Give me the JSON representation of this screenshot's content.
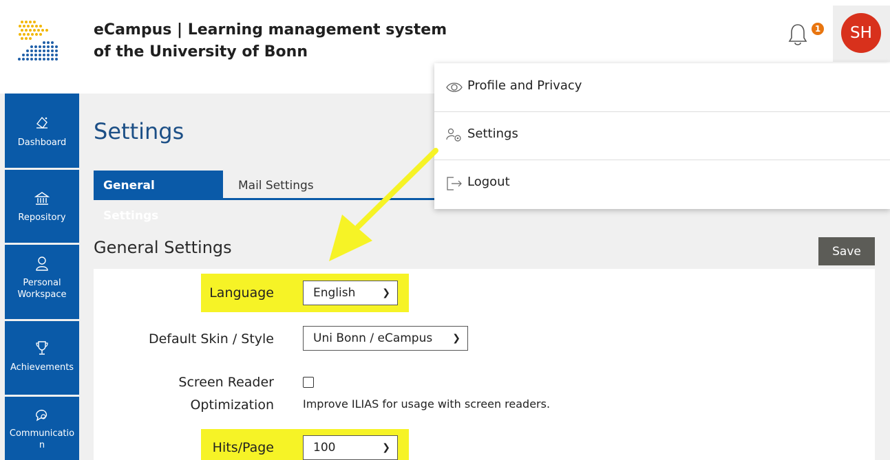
{
  "header": {
    "brand_line1": "eCampus | Learning management system",
    "brand_line2": "of the University of Bonn",
    "notification_count": "1",
    "avatar_initials": "SH"
  },
  "sidebar": {
    "items": [
      {
        "label": "Dashboard",
        "icon": "dashboard-icon"
      },
      {
        "label": "Repository",
        "icon": "repository-icon"
      },
      {
        "label": "Personal Workspace",
        "line1": "Personal",
        "line2": "Workspace",
        "icon": "person-icon"
      },
      {
        "label": "Achievements",
        "icon": "trophy-icon"
      },
      {
        "label": "Communication",
        "line1": "Communicatio",
        "line2": "n",
        "icon": "chat-icon"
      }
    ]
  },
  "page": {
    "title": "Settings",
    "tabs": [
      {
        "label": "General Settings",
        "active": true
      },
      {
        "label": "Mail Settings",
        "active": false
      }
    ],
    "section_title": "General Settings",
    "save_label": "Save"
  },
  "form": {
    "language_label": "Language",
    "language_value": "English",
    "skin_label": "Default Skin / Style",
    "skin_value": "Uni Bonn / eCampus",
    "screen_reader_label_1": "Screen Reader",
    "screen_reader_label_2": "Optimization",
    "screen_reader_help": "Improve ILIAS for usage with screen readers.",
    "screen_reader_checked": false,
    "hits_label": "Hits/Page",
    "hits_value": "100"
  },
  "user_menu": {
    "items": [
      {
        "label": "Profile and Privacy",
        "icon": "eye-icon"
      },
      {
        "label": "Settings",
        "icon": "user-settings-icon"
      },
      {
        "label": "Logout",
        "icon": "logout-icon"
      }
    ]
  },
  "colors": {
    "primary": "#0a5aa8",
    "title": "#1c4f86",
    "highlight": "#f6f326",
    "avatar": "#d8311c",
    "badge": "#e8750f",
    "save_button": "#5c5c57"
  }
}
